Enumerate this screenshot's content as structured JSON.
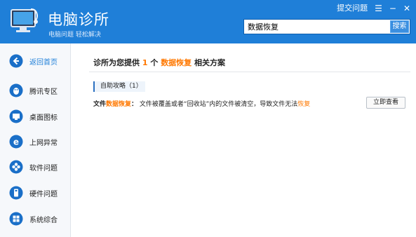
{
  "header": {
    "title": "电脑诊所",
    "subtitle": "电脑问题 轻松解决",
    "feedback_label": "提交问题",
    "menu_icon": "menu-icon",
    "minimize_icon": "minimize-icon",
    "close_icon": "close-icon",
    "search_value": "数据恢复",
    "search_button": "搜索"
  },
  "sidebar": {
    "items": [
      {
        "label": "返回首页",
        "icon": "back-arrow-icon",
        "active": true
      },
      {
        "label": "腾讯专区",
        "icon": "qq-penguin-icon"
      },
      {
        "label": "桌面图标",
        "icon": "desktop-icon"
      },
      {
        "label": "上网异常",
        "icon": "internet-explorer-icon"
      },
      {
        "label": "软件问题",
        "icon": "software-icon"
      },
      {
        "label": "硬件问题",
        "icon": "hardware-icon"
      },
      {
        "label": "系统综合",
        "icon": "windows-icon"
      }
    ]
  },
  "main": {
    "headline_prefix": "诊所为您提供",
    "headline_count": "1",
    "headline_mid": "个",
    "headline_keyword": "数据恢复",
    "headline_suffix": "相关方案",
    "section_label": "自助攻略（1）",
    "result": {
      "prefix": "文件",
      "keyword": "数据恢复",
      "colon": "：",
      "description": "文件被覆盖或者“回收站”内的文件被清空，导致文件无法",
      "end_keyword": "恢复",
      "action_label": "立即查看"
    }
  },
  "colors": {
    "header_bg": "#1f7fd8",
    "accent": "#ff7800",
    "sidebar_bg": "#f6f8fb"
  }
}
